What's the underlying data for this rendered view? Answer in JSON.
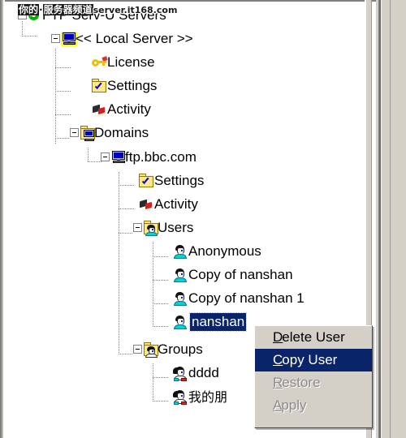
{
  "watermark": {
    "text_cjk": "你的",
    "dot": "·",
    "text_cjk2": "服务器频道",
    "url": "server.it168.com"
  },
  "window": {
    "title": "FTP Serv-U Servers"
  },
  "tree": {
    "nodes": [
      {
        "id": "root",
        "label": "FTP Serv-U Servers",
        "icon": "servu-root-icon",
        "depth": 0,
        "expander": "minus",
        "selected": false
      },
      {
        "id": "local",
        "label": "<< Local Server >>",
        "icon": "local-server-icon",
        "depth": 1,
        "expander": "minus",
        "selected": false
      },
      {
        "id": "license",
        "label": "License",
        "icon": "key-icon",
        "depth": 2,
        "expander": "none",
        "selected": false
      },
      {
        "id": "settings1",
        "label": "Settings",
        "icon": "settings-folder-icon",
        "depth": 2,
        "expander": "none",
        "selected": false
      },
      {
        "id": "activity1",
        "label": "Activity",
        "icon": "activity-icon",
        "depth": 2,
        "expander": "none",
        "selected": false
      },
      {
        "id": "domains",
        "label": "Domains",
        "icon": "domains-folder-icon",
        "depth": 2,
        "expander": "minus",
        "selected": false
      },
      {
        "id": "ftpbbc",
        "label": "ftp.bbc.com",
        "icon": "domain-computer-icon",
        "depth": 3,
        "expander": "minus",
        "selected": false
      },
      {
        "id": "settings2",
        "label": "Settings",
        "icon": "settings-folder-icon",
        "depth": 4,
        "expander": "none",
        "selected": false
      },
      {
        "id": "activity2",
        "label": "Activity",
        "icon": "activity-icon",
        "depth": 4,
        "expander": "none",
        "selected": false
      },
      {
        "id": "users",
        "label": "Users",
        "icon": "users-folder-icon",
        "depth": 4,
        "expander": "minus",
        "selected": false
      },
      {
        "id": "anonymous",
        "label": "Anonymous",
        "icon": "user-icon",
        "depth": 5,
        "expander": "none",
        "selected": false
      },
      {
        "id": "copy1",
        "label": "Copy of nanshan",
        "icon": "user-icon",
        "depth": 5,
        "expander": "none",
        "selected": false
      },
      {
        "id": "copy2",
        "label": "Copy of nanshan 1",
        "icon": "user-icon",
        "depth": 5,
        "expander": "none",
        "selected": false
      },
      {
        "id": "nanshan",
        "label": "nanshan",
        "icon": "user-icon",
        "depth": 5,
        "expander": "none",
        "selected": true
      },
      {
        "id": "groups",
        "label": "Groups",
        "icon": "groups-folder-icon",
        "depth": 4,
        "expander": "minus",
        "selected": false
      },
      {
        "id": "dddd",
        "label": "dddd",
        "icon": "group-icon",
        "depth": 5,
        "expander": "none",
        "selected": false
      },
      {
        "id": "wodepengyou",
        "label": "我的朋",
        "icon": "group-icon",
        "depth": 5,
        "expander": "none",
        "selected": false
      }
    ]
  },
  "context_menu": {
    "items": [
      {
        "label": "Delete User",
        "accel": "D",
        "enabled": true,
        "highlighted": false
      },
      {
        "label": "Copy User",
        "accel": "C",
        "enabled": true,
        "highlighted": true
      },
      {
        "label": "Restore",
        "accel": "R",
        "enabled": false,
        "highlighted": false
      },
      {
        "label": "Apply",
        "accel": "A",
        "enabled": false,
        "highlighted": false
      }
    ]
  },
  "colors": {
    "selection": "#0a246a",
    "menu_face": "#d4d0c8",
    "window_bg": "#ffffff",
    "disabled_text": "#8c8c8c"
  }
}
